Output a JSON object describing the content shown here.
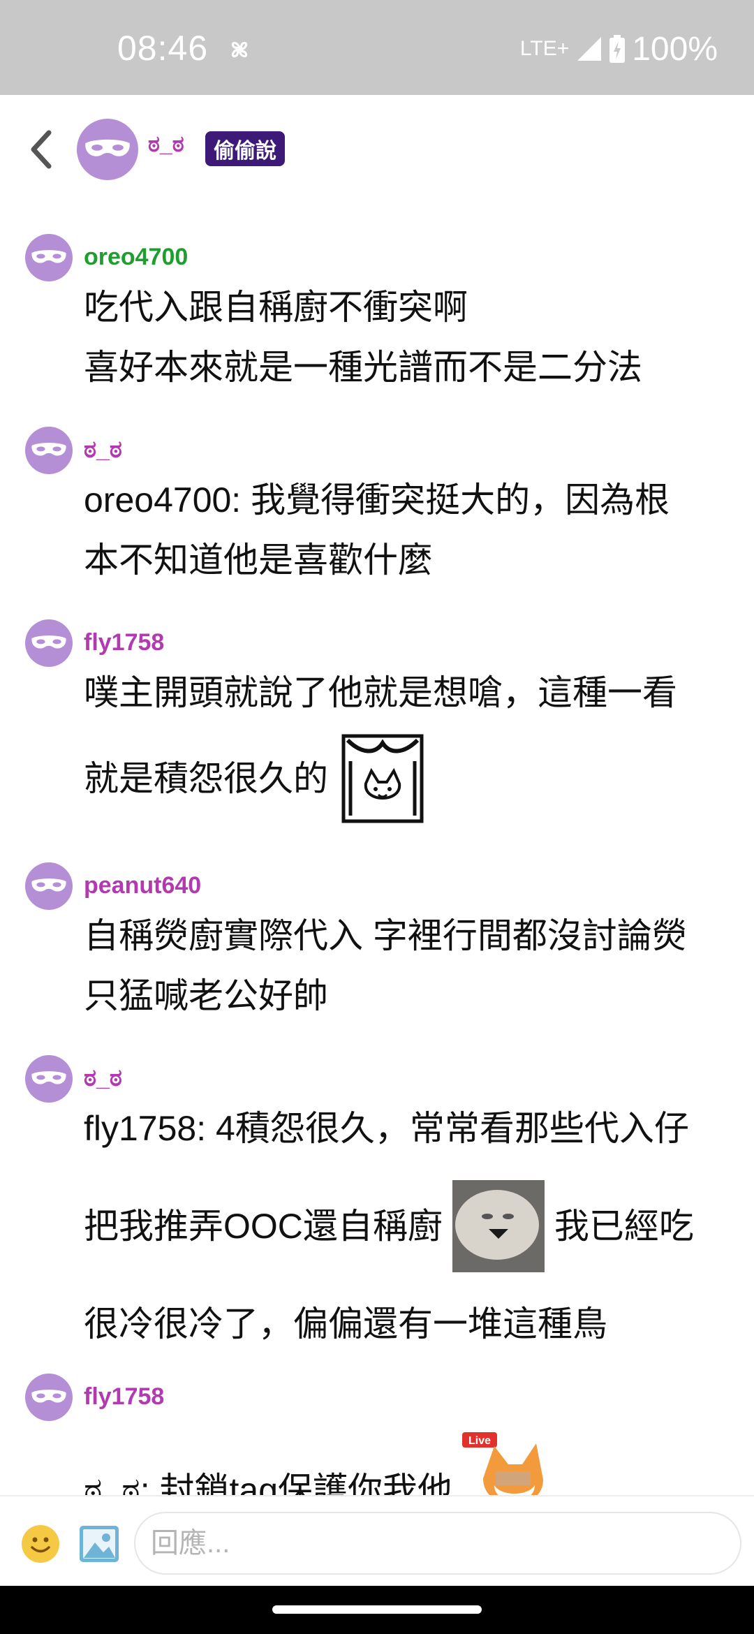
{
  "status_bar": {
    "time": "08:46",
    "network": "LTE+",
    "battery": "100%"
  },
  "header": {
    "title": "ಠ_ಠ",
    "badge": "偷偷說",
    "back_icon": "chevron-left-icon"
  },
  "colors": {
    "purple": "#b23ab0",
    "green": "#1f9e2f",
    "avatar": "#b58fd6",
    "badge_bg": "#3d1a78"
  },
  "messages": [
    {
      "user": "oreo4700",
      "lines": [
        "吃代入跟自稱廚不衝突啊",
        "喜好本來就是一種光譜而不是二分法"
      ]
    },
    {
      "user": "ಠ_ಠ",
      "lines": [
        "oreo4700: 我覺得衝突挺大的，因為根",
        "本不知道他是喜歡什麼"
      ]
    },
    {
      "user": "fly1758",
      "line1": "噗主開頭就說了他就是想嗆，這種一看",
      "line2": "就是積怨很久的"
    },
    {
      "user": "peanut640",
      "lines": [
        "自稱熒廚實際代入 字裡行間都沒討論熒",
        "只猛喊老公好帥"
      ]
    },
    {
      "user": "ಠ_ಠ",
      "line1": "fly1758: 4積怨很久，常常看那些代入仔",
      "line2a": "把我推弄OOC還自稱廚",
      "line2b": "我已經吃",
      "line3": "很冷很冷了，偏偏還有一堆這種鳥"
    },
    {
      "user": "fly1758",
      "line1": "ಠ_ಠ: 封鎖tag保護你我他",
      "sticker_label": "Live"
    }
  ],
  "reply": {
    "placeholder": "回應..."
  }
}
